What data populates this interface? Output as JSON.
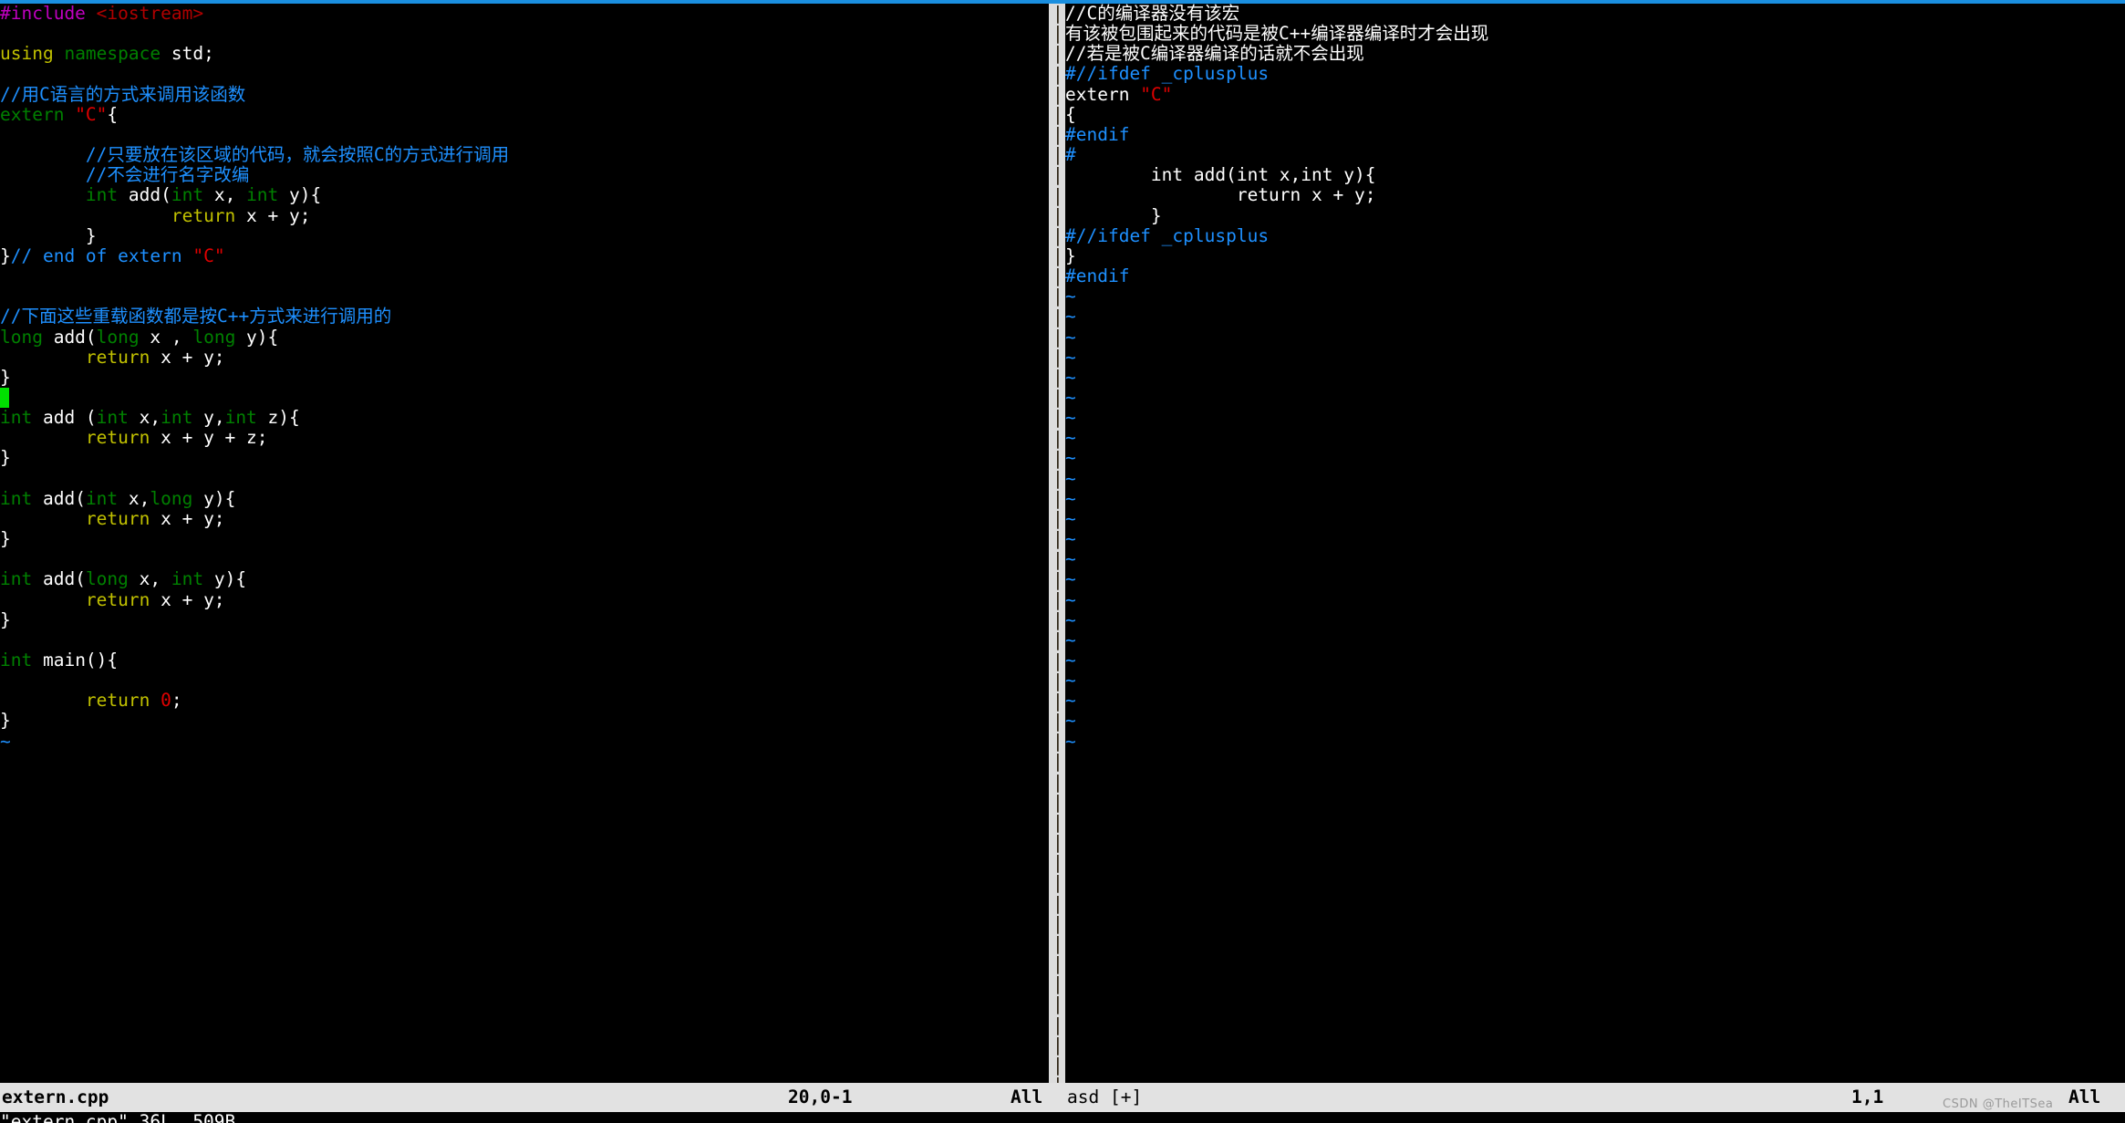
{
  "app": {
    "name": "vim",
    "top_rule_color": "#1a8fe0",
    "background": "#000000",
    "statusbar_bg": "#e2e2e2",
    "cursor_color": "#00e000"
  },
  "left_pane": {
    "filename": "extern.cpp",
    "lines": [
      [
        {
          "t": "#include ",
          "c": "c-pre"
        },
        {
          "t": "<iostream>",
          "c": "c-inc"
        }
      ],
      [],
      [
        {
          "t": "using ",
          "c": "c-stmt"
        },
        {
          "t": "namespace ",
          "c": "c-type"
        },
        {
          "t": "std;",
          "c": "c-plain"
        }
      ],
      [],
      [
        {
          "t": "//用C语言的方式来调用该函数",
          "c": "c-comment"
        }
      ],
      [
        {
          "t": "extern ",
          "c": "c-type"
        },
        {
          "t": "\"C\"",
          "c": "c-string"
        },
        {
          "t": "{",
          "c": "c-plain"
        }
      ],
      [],
      [
        {
          "t": "        //只要放在该区域的代码，就会按照C的方式进行调用",
          "c": "c-comment"
        }
      ],
      [
        {
          "t": "        //不会进行名字改编",
          "c": "c-comment"
        }
      ],
      [
        {
          "t": "        ",
          "c": "c-plain"
        },
        {
          "t": "int ",
          "c": "c-type"
        },
        {
          "t": "add(",
          "c": "c-plain"
        },
        {
          "t": "int ",
          "c": "c-type"
        },
        {
          "t": "x, ",
          "c": "c-plain"
        },
        {
          "t": "int ",
          "c": "c-type"
        },
        {
          "t": "y){",
          "c": "c-plain"
        }
      ],
      [
        {
          "t": "                ",
          "c": "c-plain"
        },
        {
          "t": "return ",
          "c": "c-stmt"
        },
        {
          "t": "x + y;",
          "c": "c-plain"
        }
      ],
      [
        {
          "t": "        }",
          "c": "c-plain"
        }
      ],
      [
        {
          "t": "}",
          "c": "c-plain"
        },
        {
          "t": "// end of extern ",
          "c": "c-comment"
        },
        {
          "t": "\"C\"",
          "c": "c-string"
        }
      ],
      [],
      [],
      [
        {
          "t": "//下面这些重载函数都是按C++方式来进行调用的",
          "c": "c-comment"
        }
      ],
      [
        {
          "t": "long ",
          "c": "c-type"
        },
        {
          "t": "add(",
          "c": "c-plain"
        },
        {
          "t": "long ",
          "c": "c-type"
        },
        {
          "t": "x , ",
          "c": "c-plain"
        },
        {
          "t": "long ",
          "c": "c-type"
        },
        {
          "t": "y){",
          "c": "c-plain"
        }
      ],
      [
        {
          "t": "        ",
          "c": "c-plain"
        },
        {
          "t": "return ",
          "c": "c-stmt"
        },
        {
          "t": "x + y;",
          "c": "c-plain"
        }
      ],
      [
        {
          "t": "}",
          "c": "c-plain"
        }
      ],
      [
        {
          "t": "",
          "c": "cursor"
        }
      ],
      [
        {
          "t": "int ",
          "c": "c-type"
        },
        {
          "t": "add (",
          "c": "c-plain"
        },
        {
          "t": "int ",
          "c": "c-type"
        },
        {
          "t": "x,",
          "c": "c-plain"
        },
        {
          "t": "int ",
          "c": "c-type"
        },
        {
          "t": "y,",
          "c": "c-plain"
        },
        {
          "t": "int ",
          "c": "c-type"
        },
        {
          "t": "z){",
          "c": "c-plain"
        }
      ],
      [
        {
          "t": "        ",
          "c": "c-plain"
        },
        {
          "t": "return ",
          "c": "c-stmt"
        },
        {
          "t": "x + y + z;",
          "c": "c-plain"
        }
      ],
      [
        {
          "t": "}",
          "c": "c-plain"
        }
      ],
      [],
      [
        {
          "t": "int ",
          "c": "c-type"
        },
        {
          "t": "add(",
          "c": "c-plain"
        },
        {
          "t": "int ",
          "c": "c-type"
        },
        {
          "t": "x,",
          "c": "c-plain"
        },
        {
          "t": "long ",
          "c": "c-type"
        },
        {
          "t": "y){",
          "c": "c-plain"
        }
      ],
      [
        {
          "t": "        ",
          "c": "c-plain"
        },
        {
          "t": "return ",
          "c": "c-stmt"
        },
        {
          "t": "x + y;",
          "c": "c-plain"
        }
      ],
      [
        {
          "t": "}",
          "c": "c-plain"
        }
      ],
      [],
      [
        {
          "t": "int ",
          "c": "c-type"
        },
        {
          "t": "add(",
          "c": "c-plain"
        },
        {
          "t": "long ",
          "c": "c-type"
        },
        {
          "t": "x, ",
          "c": "c-plain"
        },
        {
          "t": "int ",
          "c": "c-type"
        },
        {
          "t": "y){",
          "c": "c-plain"
        }
      ],
      [
        {
          "t": "        ",
          "c": "c-plain"
        },
        {
          "t": "return ",
          "c": "c-stmt"
        },
        {
          "t": "x + y;",
          "c": "c-plain"
        }
      ],
      [
        {
          "t": "}",
          "c": "c-plain"
        }
      ],
      [],
      [
        {
          "t": "int ",
          "c": "c-type"
        },
        {
          "t": "main(){",
          "c": "c-plain"
        }
      ],
      [],
      [
        {
          "t": "        ",
          "c": "c-plain"
        },
        {
          "t": "return ",
          "c": "c-stmt"
        },
        {
          "t": "0",
          "c": "c-num"
        },
        {
          "t": ";",
          "c": "c-plain"
        }
      ],
      [
        {
          "t": "}",
          "c": "c-plain"
        }
      ],
      [
        {
          "t": "~",
          "c": "c-tilde"
        }
      ]
    ]
  },
  "right_pane": {
    "filename": "asd [+]",
    "lines": [
      [
        {
          "t": "//C的编译器没有该宏",
          "c": "c-plain"
        }
      ],
      [
        {
          "t": "有该被包围起来的代码是被C++编译器编译时才会出现",
          "c": "c-plain"
        }
      ],
      [
        {
          "t": "//若是被C编译器编译的话就不会出现",
          "c": "c-plain"
        }
      ],
      [
        {
          "t": "#//ifdef _cplusplus",
          "c": "c-blue"
        }
      ],
      [
        {
          "t": "extern ",
          "c": "c-plain"
        },
        {
          "t": "\"C\"",
          "c": "c-string"
        }
      ],
      [
        {
          "t": "{",
          "c": "c-plain"
        }
      ],
      [
        {
          "t": "#endif",
          "c": "c-blue"
        }
      ],
      [
        {
          "t": "#",
          "c": "c-blue"
        }
      ],
      [
        {
          "t": "        int add(int x,int y){",
          "c": "c-plain"
        }
      ],
      [
        {
          "t": "                return x + y;",
          "c": "c-plain"
        }
      ],
      [
        {
          "t": "        }",
          "c": "c-plain"
        }
      ],
      [
        {
          "t": "#//ifdef _cplusplus",
          "c": "c-blue"
        }
      ],
      [
        {
          "t": "}",
          "c": "c-plain"
        }
      ],
      [
        {
          "t": "#endif",
          "c": "c-blue"
        }
      ],
      [
        {
          "t": "~",
          "c": "c-tilde"
        }
      ],
      [
        {
          "t": "~",
          "c": "c-tilde"
        }
      ],
      [
        {
          "t": "~",
          "c": "c-tilde"
        }
      ],
      [
        {
          "t": "~",
          "c": "c-tilde"
        }
      ],
      [
        {
          "t": "~",
          "c": "c-tilde"
        }
      ],
      [
        {
          "t": "~",
          "c": "c-tilde"
        }
      ],
      [
        {
          "t": "~",
          "c": "c-tilde"
        }
      ],
      [
        {
          "t": "~",
          "c": "c-tilde"
        }
      ],
      [
        {
          "t": "~",
          "c": "c-tilde"
        }
      ],
      [
        {
          "t": "~",
          "c": "c-tilde"
        }
      ],
      [
        {
          "t": "~",
          "c": "c-tilde"
        }
      ],
      [
        {
          "t": "~",
          "c": "c-tilde"
        }
      ],
      [
        {
          "t": "~",
          "c": "c-tilde"
        }
      ],
      [
        {
          "t": "~",
          "c": "c-tilde"
        }
      ],
      [
        {
          "t": "~",
          "c": "c-tilde"
        }
      ],
      [
        {
          "t": "~",
          "c": "c-tilde"
        }
      ],
      [
        {
          "t": "~",
          "c": "c-tilde"
        }
      ],
      [
        {
          "t": "~",
          "c": "c-tilde"
        }
      ],
      [
        {
          "t": "~",
          "c": "c-tilde"
        }
      ],
      [
        {
          "t": "~",
          "c": "c-tilde"
        }
      ],
      [
        {
          "t": "~",
          "c": "c-tilde"
        }
      ],
      [
        {
          "t": "~",
          "c": "c-tilde"
        }
      ],
      [
        {
          "t": "~",
          "c": "c-tilde"
        }
      ]
    ]
  },
  "statusline": {
    "left_file": "extern.cpp",
    "left_position": "20,0-1",
    "left_percent": "All",
    "right_file": "asd [+]",
    "right_position": "1,1",
    "right_percent": "All"
  },
  "watermark": "CSDN @TheITSea",
  "cmdline": "\"extern.cpp\" 36L, 509B"
}
